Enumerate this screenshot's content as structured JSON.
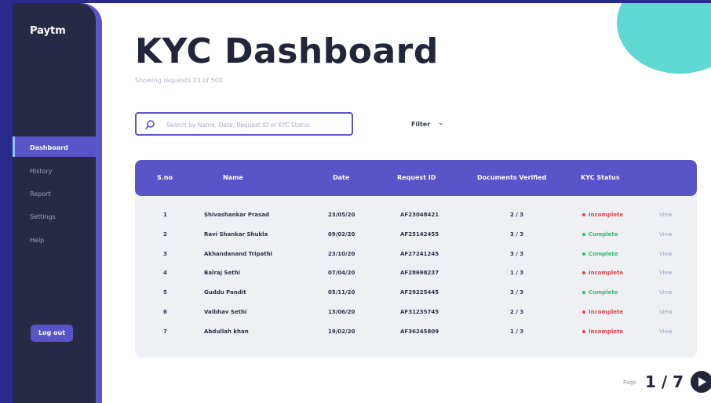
{
  "sidebar": {
    "brand": "Paytm",
    "items": [
      {
        "label": "Dashboard",
        "active": true
      },
      {
        "label": "History",
        "active": false
      },
      {
        "label": "Report",
        "active": false
      },
      {
        "label": "Settings",
        "active": false
      },
      {
        "label": "Help",
        "active": false
      }
    ],
    "logout_label": "Log out"
  },
  "header": {
    "title": "KYC Dashboard",
    "subtitle": "Showing requests 23 of 500"
  },
  "search": {
    "placeholder": "Search by Name, Date, Request ID or KYC Status"
  },
  "filter": {
    "label": "Filter"
  },
  "table": {
    "columns": [
      "S.no",
      "Name",
      "Date",
      "Request ID",
      "Documents Verified",
      "KYC Status"
    ],
    "view_label": "View",
    "rows": [
      {
        "sno": "1",
        "name": "Shivashankar Prasad",
        "date": "23/05/20",
        "request_id": "AF23048421",
        "docs": "2 / 3",
        "status": "Incomplete"
      },
      {
        "sno": "2",
        "name": "Ravi Shankar Shukla",
        "date": "09/02/20",
        "request_id": "AF25142455",
        "docs": "3 / 3",
        "status": "Complete"
      },
      {
        "sno": "3",
        "name": "Akhandanand Tripathi",
        "date": "23/10/20",
        "request_id": "AF27241245",
        "docs": "3 / 3",
        "status": "Complete"
      },
      {
        "sno": "4",
        "name": "Balraj Sethi",
        "date": "07/04/20",
        "request_id": "AF28698237",
        "docs": "1 / 3",
        "status": "Incomplete"
      },
      {
        "sno": "5",
        "name": "Guddu Pandit",
        "date": "05/11/20",
        "request_id": "AF29225445",
        "docs": "3 / 3",
        "status": "Complete"
      },
      {
        "sno": "6",
        "name": "Vaibhav Sethi",
        "date": "13/06/20",
        "request_id": "AF31235745",
        "docs": "2 / 3",
        "status": "Incomplete"
      },
      {
        "sno": "7",
        "name": "Abdullah khan",
        "date": "19/02/20",
        "request_id": "AF36245809",
        "docs": "1 / 3",
        "status": "Incomplete"
      }
    ]
  },
  "pagination": {
    "label": "Page",
    "value": "1 / 7"
  },
  "colors": {
    "accent": "#5a54c9",
    "sidebar": "#262a45",
    "complete": "#2fbf71",
    "incomplete": "#e0434b",
    "deco": "#5fd8d4"
  }
}
